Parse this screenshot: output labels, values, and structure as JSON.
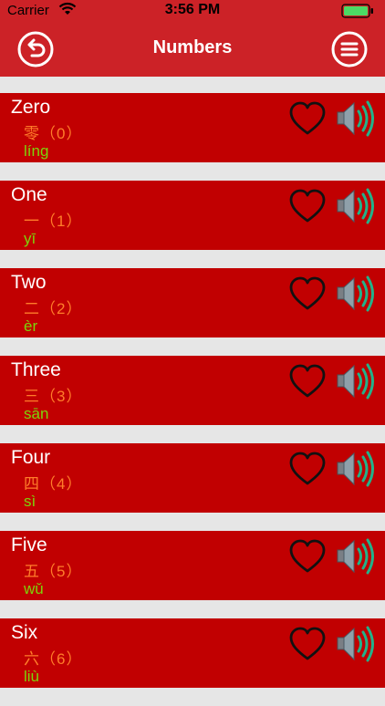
{
  "status": {
    "carrier": "Carrier",
    "time": "3:56 PM"
  },
  "header": {
    "title": "Numbers"
  },
  "icons": {
    "back": "back-circle-icon",
    "menu": "menu-circle-icon",
    "favorite": "heart-outline-icon",
    "audio": "speaker-icon"
  },
  "colors": {
    "header": "#cc2227",
    "row": "#c10001",
    "english": "#ffffff",
    "chinese": "#ff7d2a",
    "pinyin": "#7cd40b",
    "separator": "#e6e6e6"
  },
  "items": [
    {
      "english": "Zero",
      "chinese": "零（0）",
      "pinyin": "líng"
    },
    {
      "english": "One",
      "chinese": "一（1）",
      "pinyin": "yī"
    },
    {
      "english": "Two",
      "chinese": "二（2）",
      "pinyin": "èr"
    },
    {
      "english": "Three",
      "chinese": "三（3）",
      "pinyin": "sān"
    },
    {
      "english": "Four",
      "chinese": "四（4）",
      "pinyin": "sì"
    },
    {
      "english": "Five",
      "chinese": "五（5）",
      "pinyin": "wǔ"
    },
    {
      "english": "Six",
      "chinese": "六（6）",
      "pinyin": "liù"
    }
  ]
}
